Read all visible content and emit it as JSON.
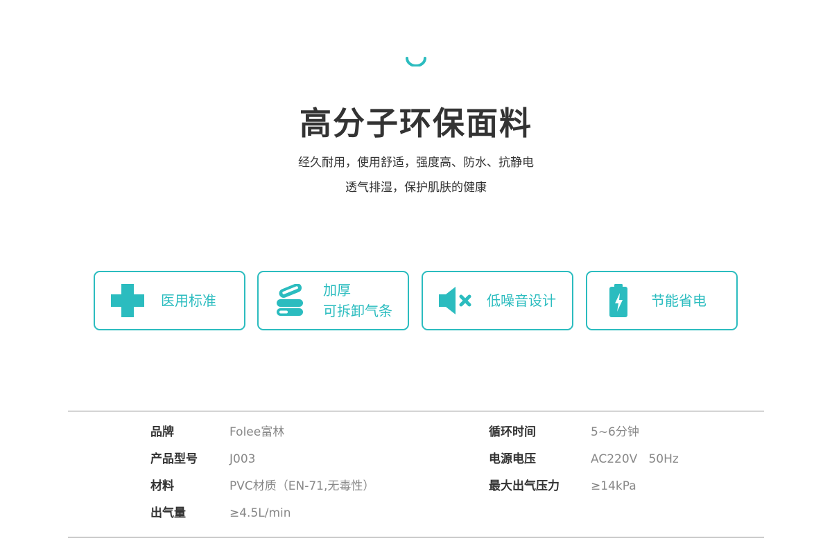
{
  "theme": {
    "accent": "#2bbcbf",
    "text": "#333333",
    "muted": "#888888"
  },
  "header": {
    "title": "高分子环保面料",
    "subtitle_line1": "经久耐用，使用舒适，强度高、防水、抗静电",
    "subtitle_line2": "透气排湿，保护肌肤的健康"
  },
  "features": [
    {
      "icon": "medical-cross-icon",
      "lines": [
        "医用标准"
      ]
    },
    {
      "icon": "air-tubes-icon",
      "lines": [
        "加厚",
        "可拆卸气条"
      ]
    },
    {
      "icon": "speaker-mute-icon",
      "lines": [
        "低噪音设计"
      ]
    },
    {
      "icon": "battery-charge-icon",
      "lines": [
        "节能省电"
      ]
    }
  ],
  "specs": {
    "left": [
      {
        "key": "品牌",
        "value": "Folee富林"
      },
      {
        "key": "产品型号",
        "value": "J003"
      },
      {
        "key": "材料",
        "value": "PVC材质（EN-71,无毒性）"
      },
      {
        "key": "出气量",
        "value": "≥4.5L/min"
      }
    ],
    "right": [
      {
        "key": "循环时间",
        "value": "5~6分钟"
      },
      {
        "key": "电源电压",
        "value": "AC220V   50Hz"
      },
      {
        "key": "最大出气压力",
        "value": "≥14kPa"
      }
    ]
  }
}
